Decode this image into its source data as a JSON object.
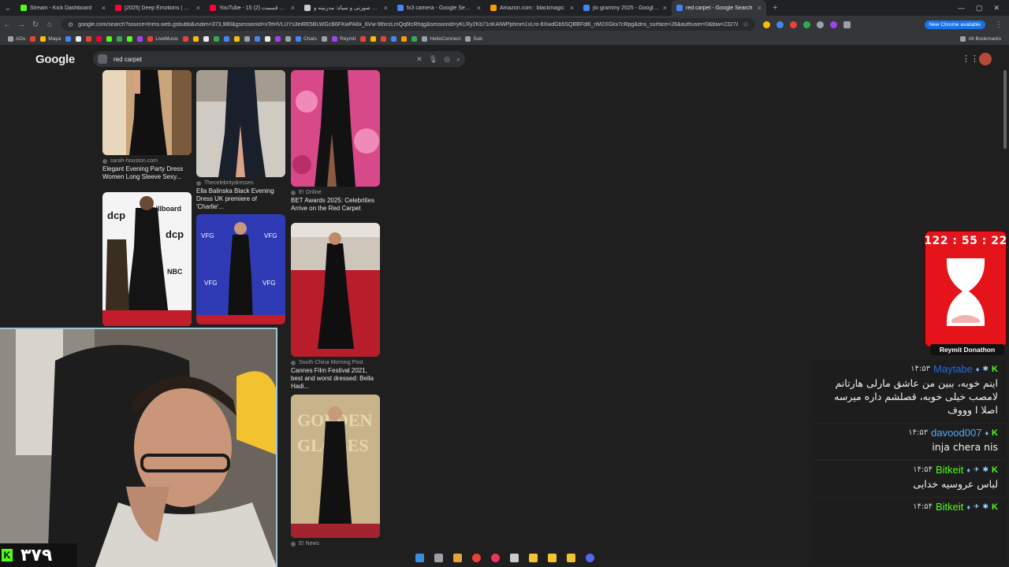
{
  "tabs": [
    {
      "title": "Stream - Kick Dashboard",
      "favicon_color": "#53fc18",
      "active": false
    },
    {
      "title": "[2025] Deep Emotions | Cigarette...",
      "favicon_color": "#ff0033",
      "active": false
    },
    {
      "title": "YouTube - 15 زن روز قسمت (2)",
      "favicon_color": "#ff0033",
      "active": false
    },
    {
      "title": "ترکیب صورتی و سیاه: مدرنیته و...",
      "favicon_color": "#c9cbcf",
      "active": false
    },
    {
      "title": "fx3 camera - Google Search",
      "favicon_color": "#4285f4",
      "active": false
    },
    {
      "title": "Amazon.com : blackmagic",
      "favicon_color": "#ff9900",
      "active": false
    },
    {
      "title": "jlo grammy 2025 - Google Search",
      "favicon_color": "#4285f4",
      "active": false
    },
    {
      "title": "red carpet - Google Search",
      "favicon_color": "#4285f4",
      "active": true
    }
  ],
  "address_bar": {
    "url": "google.com/search?source=lnms.web.gsbubb&vsdim=373,980&gsessionid=xTeHVLUYs3eiRE5BLWGcB6FKwPA6x_6Vw-9tfxrzLmQq6fcRhqg&sessionid=yKLRy2Kb71nKAIWPphmm1xLro-8XwdGb5SQBBFdl6_nM2XGkx7cRpg&dns_surface=26&authuser=0&biw=2327&bih=115..."
  },
  "update_chip": "New Chrome available",
  "bookmarks": [
    "ADs",
    "Maya",
    "LiveMusic",
    "Chats",
    "Reymit",
    "HelioConnect",
    "Sub"
  ],
  "all_bookmarks": "All Bookmarks",
  "google": {
    "logo": "Google",
    "query": "red carpet"
  },
  "results": [
    {
      "source": "sarah-houston.com",
      "caption": "Elegant Evening Party Dress Women Long Sleeve Sexy...",
      "bg": "#caa47a"
    },
    {
      "source": "Thecelebritydresses",
      "caption": "Ella Balinska Black Evening Dress UK premiere of 'Charlie'...",
      "bg": "#cfcac2"
    },
    {
      "source": "E! Online",
      "caption": "BET Awards 2025: Celebrities Arrive on the Red Carpet",
      "bg": "#d8498a"
    },
    {
      "source": "",
      "caption": "",
      "bg": "#f4f4f4"
    },
    {
      "source": "",
      "caption": "",
      "bg": "#2f3bb5"
    },
    {
      "source": "South China Morning Post",
      "caption": "Cannes Film Festival 2021, best and worst dressed: Bella Hadi...",
      "bg": "#b81d2c"
    },
    {
      "source": "E! News",
      "caption": "",
      "bg": "#c9b38a"
    }
  ],
  "timer": {
    "time": "122 : 55 : 22",
    "label": "Reymit Donathon"
  },
  "chat": [
    {
      "time": "۱۴:۵۳",
      "user": "Maytabe",
      "user_color": "#1e6fd9",
      "text": "اینم خوبه، ببین من عاشق مارلی هارتانم لامصب خیلی خوبه، قصلشم داره میرسه اصلا ا وووف"
    },
    {
      "time": "۱۴:۵۳",
      "user": "davood007",
      "user_color": "#54a9ff",
      "text": "inja chera nis"
    },
    {
      "time": "۱۴:۵۴",
      "user": "Bitkeit",
      "user_color": "#53fc18",
      "text": "لباس عروسیه خدایی"
    },
    {
      "time": "۱۴:۵۴",
      "user": "Bitkeit",
      "user_color": "#53fc18",
      "text": ""
    }
  ],
  "viewer_count": "۳۷۹",
  "kick_letter": "K"
}
